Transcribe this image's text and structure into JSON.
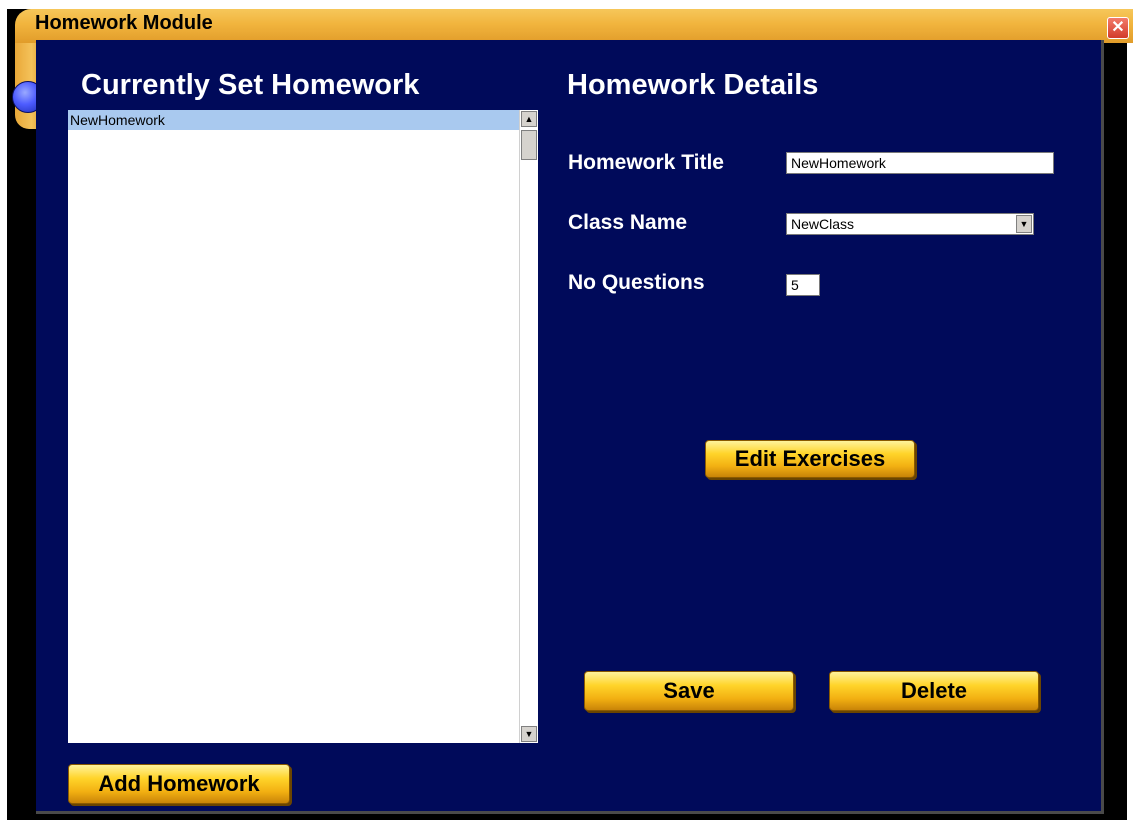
{
  "window": {
    "title": "Homework Module",
    "close_icon": "close-icon"
  },
  "list_panel": {
    "heading": "Currently Set Homework",
    "items": [
      {
        "label": "NewHomework",
        "selected": true
      }
    ],
    "add_button": "Add Homework"
  },
  "details": {
    "heading": "Homework Details",
    "title_label": "Homework Title",
    "title_value": "NewHomework",
    "class_label": "Class Name",
    "class_value": "NewClass",
    "questions_label": "No Questions",
    "questions_value": "5",
    "edit_button": "Edit Exercises",
    "save_button": "Save",
    "delete_button": "Delete"
  },
  "colors": {
    "panel_bg": "#000a5a",
    "title_bar": "#f1b43d",
    "button_gold": "#ffd42a",
    "selection": "#a9c9ef"
  }
}
